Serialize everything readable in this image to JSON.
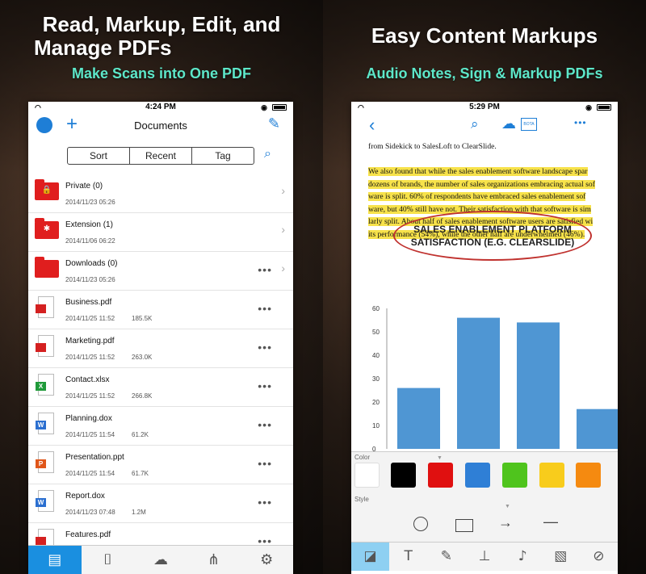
{
  "left": {
    "headline": [
      "Read, Markup, Edit, and",
      "Manage PDFs"
    ],
    "subline": "Make Scans into One PDF",
    "status_time": "4:24 PM",
    "nav_title": "Documents",
    "segments": [
      "Sort",
      "Recent",
      "Tag"
    ],
    "rows": [
      {
        "name": "Private (0)",
        "date": "2014/11/23 05:26",
        "size": "",
        "kind": "folder",
        "glyph": "🔒",
        "dots": "",
        "chev": "›"
      },
      {
        "name": "Extension (1)",
        "date": "2014/11/06 06:22",
        "size": "",
        "kind": "folder",
        "glyph": "✱",
        "dots": "",
        "chev": "›"
      },
      {
        "name": "Downloads (0)",
        "date": "2014/11/23 05:26",
        "size": "",
        "kind": "folder",
        "glyph": "",
        "dots": "•••",
        "chev": "›"
      },
      {
        "name": "Business.pdf",
        "date": "2014/11/25 11:52",
        "size": "185.5K",
        "kind": "pdf",
        "glyph": "",
        "dots": "•••",
        "chev": ""
      },
      {
        "name": "Marketing.pdf",
        "date": "2014/11/25 11:52",
        "size": "263.0K",
        "kind": "pdf",
        "glyph": "",
        "dots": "•••",
        "chev": ""
      },
      {
        "name": "Contact.xlsx",
        "date": "2014/11/25 11:52",
        "size": "266.8K",
        "kind": "xlsx",
        "glyph": "X",
        "dots": "•••",
        "chev": ""
      },
      {
        "name": "Planning.dox",
        "date": "2014/11/25 11:54",
        "size": "61.2K",
        "kind": "doc",
        "glyph": "W",
        "dots": "•••",
        "chev": ""
      },
      {
        "name": "Presentation.ppt",
        "date": "2014/11/25 11:54",
        "size": "61.7K",
        "kind": "ppt",
        "glyph": "P",
        "dots": "•••",
        "chev": ""
      },
      {
        "name": "Report.dox",
        "date": "2014/11/23 07:48",
        "size": "1.2M",
        "kind": "doc",
        "glyph": "W",
        "dots": "•••",
        "chev": ""
      },
      {
        "name": "Features.pdf",
        "date": "",
        "size": "",
        "kind": "pdf",
        "glyph": "",
        "dots": "•••",
        "chev": ""
      }
    ],
    "tabs": [
      {
        "icon": "document-list-icon",
        "glyph": "▤",
        "active": true
      },
      {
        "icon": "camera-icon",
        "glyph": "⌷",
        "active": false
      },
      {
        "icon": "cloud-download-icon",
        "glyph": "☁",
        "active": false
      },
      {
        "icon": "connect-icon",
        "glyph": "⋔",
        "active": false
      },
      {
        "icon": "gear-icon",
        "glyph": "⚙",
        "active": false
      }
    ]
  },
  "right": {
    "headline": "Easy Content Markups",
    "subline": "Audio Notes, Sign & Markup PDFs",
    "status_time": "5:29 PM",
    "doc_lines": [
      {
        "text": "from Sidekick to SalesLoft to ClearSlide.",
        "hl": false
      },
      {
        "text": "",
        "hl": false
      },
      {
        "text": "We also found that while the sales enablement software landscape spar",
        "hl": true
      },
      {
        "text": "dozens of brands, the number of sales organizations embracing actual sof",
        "hl": true
      },
      {
        "text": "ware is split. 60% of respondents have embraced sales enablement sof",
        "hl": true
      },
      {
        "text": "ware, but 40% still have not. Their satisfaction with that software is sim",
        "hl": true
      },
      {
        "text": "larly split. About half of sales enablement software users are satisfied wi",
        "hl": true
      },
      {
        "text": "its performance (54%), while the other half are underwhelmed (46%).",
        "hl": true
      }
    ],
    "chart_title_lines": [
      "SALES ENABLEMENT PLATFORM",
      "SATISFACTION (E.G. CLEARSLIDE)"
    ],
    "color_label": "Color",
    "style_label": "Style",
    "colors": [
      "#ffffff",
      "#000000",
      "#e01010",
      "#2f7fd6",
      "#4fc41d",
      "#f8cc1c",
      "#f58a10"
    ],
    "tools": [
      {
        "icon": "shape-tool-icon",
        "glyph": "◪",
        "active": true
      },
      {
        "icon": "text-tool-icon",
        "glyph": "T",
        "active": false
      },
      {
        "icon": "pen-tool-icon",
        "glyph": "✎",
        "active": false
      },
      {
        "icon": "stamp-tool-icon",
        "glyph": "⊥",
        "active": false
      },
      {
        "icon": "microphone-tool-icon",
        "glyph": "♪",
        "active": false
      },
      {
        "icon": "image-tool-icon",
        "glyph": "▧",
        "active": false
      },
      {
        "icon": "link-tool-icon",
        "glyph": "⊘",
        "active": false
      }
    ]
  },
  "chart_data": {
    "type": "bar",
    "title": "SALES ENABLEMENT PLATFORM SATISFACTION (E.G. CLEARSLIDE)",
    "ylabel": "",
    "ylim": [
      0,
      60
    ],
    "yticks": [
      "60",
      "50",
      "40",
      "30",
      "20",
      "10",
      "0"
    ],
    "categories": [
      "",
      "",
      "",
      ""
    ],
    "values": [
      26,
      56,
      54,
      17
    ]
  }
}
